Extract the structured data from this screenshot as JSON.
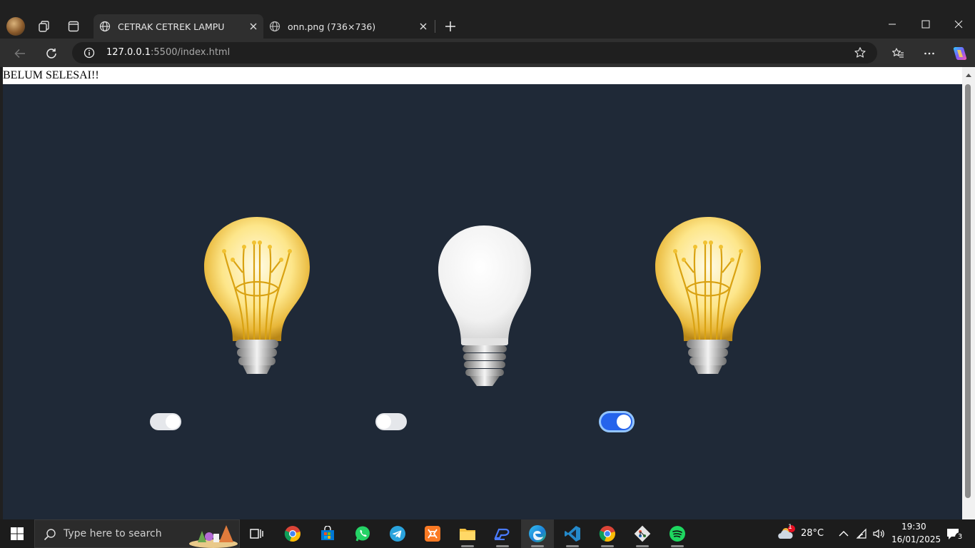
{
  "browser": {
    "tabs": [
      {
        "title": "CETRAK CETREK LAMPU",
        "favicon": "globe-icon",
        "active": true
      },
      {
        "title": "onn.png (736×736)",
        "favicon": "globe-icon",
        "active": false
      }
    ],
    "address": {
      "host": "127.0.0.1",
      "path": ":5500/index.html"
    }
  },
  "page": {
    "notice": "BELUM SELESAI!!",
    "background": "#1f2937",
    "lamps": [
      {
        "name": "lamp-1",
        "state": "on",
        "toggle_on": false
      },
      {
        "name": "lamp-2",
        "state": "off",
        "toggle_on": false
      },
      {
        "name": "lamp-3",
        "state": "on",
        "toggle_on": true
      }
    ],
    "accent": "#2563eb"
  },
  "taskbar": {
    "search_placeholder": "Type here to search",
    "apps": [
      "task-view-icon",
      "chrome-icon",
      "store-icon",
      "whatsapp-icon",
      "telegram-icon",
      "xampp-icon",
      "file-explorer-icon",
      "remote-app-icon",
      "edge-icon",
      "vscode-icon",
      "chrome-icon",
      "git-icon",
      "spotify-icon"
    ],
    "weather": {
      "temp": "28°C",
      "badge": "1"
    },
    "clock": {
      "time": "19:30",
      "date": "16/01/2025"
    },
    "notifications": "3"
  }
}
